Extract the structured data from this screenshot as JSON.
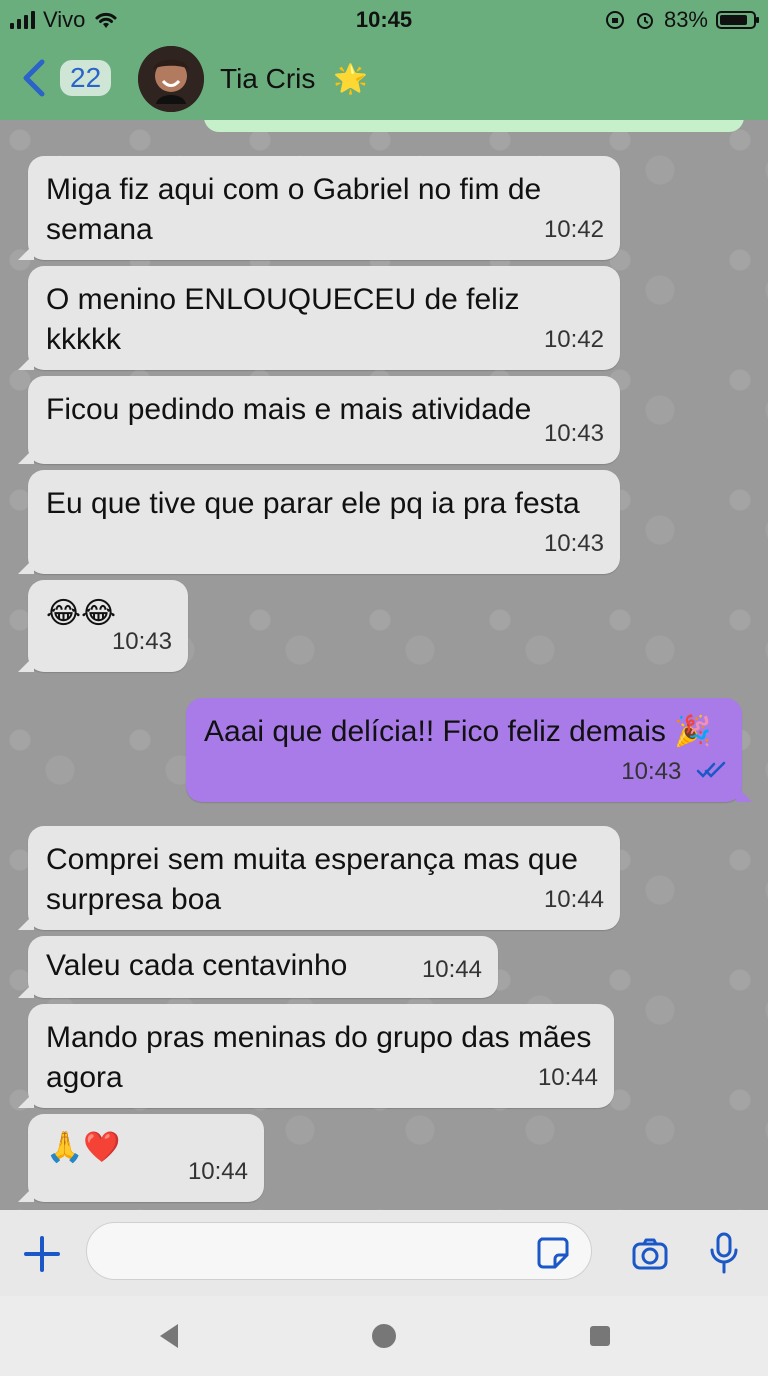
{
  "status": {
    "carrier": "Vivo",
    "time": "10:45",
    "battery": "83%",
    "battery_level": 0.83,
    "icons": [
      "signal-icon",
      "wifi-icon",
      "screen-rotation-lock-icon",
      "alarm-icon",
      "battery-icon"
    ]
  },
  "header": {
    "back_count": "22",
    "contact_name": "Tia Cris",
    "contact_emoji": "🌟",
    "icons": [
      "chevron-left-icon",
      "avatar"
    ]
  },
  "messages": [
    {
      "dir": "in",
      "text": "Miga fiz aqui com o Gabriel no fim de semana",
      "time": "10:42"
    },
    {
      "dir": "in",
      "text": "O menino ENLOUQUECEU de feliz kkkkk",
      "time": "10:42"
    },
    {
      "dir": "in",
      "text": "Ficou pedindo mais e mais atividade",
      "time": "10:43"
    },
    {
      "dir": "in",
      "text": "Eu que tive que parar ele pq ia pra festa",
      "time": "10:43"
    },
    {
      "dir": "in",
      "text": "😂😂",
      "time": "10:43"
    },
    {
      "dir": "out",
      "text": "Aaai que delícia!! Fico feliz demais 🎉",
      "time": "10:43",
      "read": true
    },
    {
      "dir": "in",
      "text": "Comprei sem muita esperança mas que surpresa boa",
      "time": "10:44"
    },
    {
      "dir": "in",
      "text": "Valeu cada centavinho",
      "time": "10:44"
    },
    {
      "dir": "in",
      "text": "Mando pras meninas do grupo das mães agora",
      "time": "10:44"
    },
    {
      "dir": "in",
      "text": "🙏❤️",
      "time": "10:44"
    }
  ],
  "input": {
    "placeholder": "",
    "icons": [
      "plus-icon",
      "sticker-icon",
      "camera-icon",
      "microphone-icon"
    ]
  },
  "android_nav": {
    "icons": [
      "back-triangle-icon",
      "home-circle-icon",
      "recents-square-icon"
    ]
  },
  "colors": {
    "header": "#6aae7e",
    "outgoing_bubble": "#a87be8",
    "incoming_bubble": "#e6e6e6",
    "accent": "#1b57c7"
  }
}
